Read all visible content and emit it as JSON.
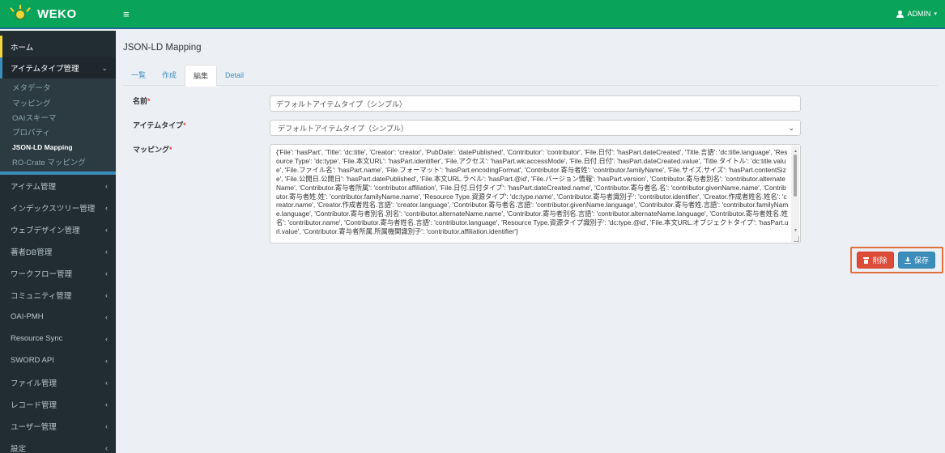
{
  "app": {
    "logo_text": "WEKO"
  },
  "header": {
    "user_label": "ADMIN",
    "user_caret": "▾",
    "menu_icon": "≡"
  },
  "sidebar": {
    "home": "ホーム",
    "active_section": {
      "label": "アイテムタイプ管理",
      "chevron": "⌄"
    },
    "sub_items": [
      "メタデータ",
      "マッピング",
      "OAIスキーマ",
      "プロパティ",
      "JSON-LD Mapping",
      "RO-Crate マッピング"
    ],
    "current_sub_index": 4,
    "sections": [
      "アイテム管理",
      "インデックスツリー管理",
      "ウェブデザイン管理",
      "著者DB管理",
      "ワークフロー管理",
      "コミュニティ管理",
      "OAI-PMH",
      "Resource Sync",
      "SWORD API",
      "ファイル管理",
      "レコード管理",
      "ユーザー管理",
      "設定"
    ],
    "chevron": "‹"
  },
  "page": {
    "title": "JSON-LD Mapping",
    "tabs": [
      "一覧",
      "作成",
      "編集",
      "Detail"
    ],
    "active_tab_index": 2
  },
  "form": {
    "name_label": "名前",
    "name_value": "デフォルトアイテムタイプ（シンプル）",
    "itemtype_label": "アイテムタイプ",
    "itemtype_value": "デフォルトアイテムタイプ（シンプル）",
    "mapping_label": "マッピング",
    "required_mark": "*",
    "mapping_value": "{'File': 'hasPart', 'Title': 'dc:title', 'Creator': 'creator', 'PubDate': 'datePublished', 'Contributor': 'contributor', 'File.日付': 'hasPart.dateCreated', 'Title.言語': 'dc:title.language', 'Resource Type': 'dc:type', 'File.本文URL': 'hasPart.identifier', 'File.アクセス': 'hasPart.wk:accessMode', 'File.日付.日付': 'hasPart.dateCreated.value', 'Title.タイトル': 'dc:title.value', 'File.ファイル名': 'hasPart.name', 'File.フォーマット': 'hasPart.encodingFormat', 'Contributor.寄与者姓': 'contributor.familyName', 'File.サイズ.サイズ': 'hasPart.contentSize', 'File.公開日.公開日': 'hasPart.datePublished', 'File.本文URL.ラベル': 'hasPart.@id', 'File.バージョン情報': 'hasPart.version', 'Contributor.寄与者別名': 'contributor.alternateName', 'Contributor.寄与者所属': 'contributor.affiliation', 'File.日付.日付タイプ': 'hasPart.dateCreated.name', 'Contributor.寄与者名.名': 'contributor.givenName.name', 'Contributor.寄与者姓.姓': 'contributor.familyName.name', 'Resource Type.資源タイプ': 'dc:type.name', 'Contributor.寄与者識別子': 'contributor.identifier', 'Creator.作成者姓名.姓名': 'creator.name', 'Creator.作成者姓名.言語': 'creator.language', 'Contributor.寄与者名.言語': 'contributor.givenName.language', 'Contributor.寄与者姓.言語': 'contributor.familyName.language', 'Contributor.寄与者別名.別名': 'contributor.alternateName.name', 'Contributor.寄与者別名.言語': 'contributor.alternateName.language', 'Contributor.寄与者姓名.姓名': 'contributor.name', 'Contributor.寄与者姓名.言語': 'contributor.language', 'Resource Type.資源タイプ識別子': 'dc:type.@id', 'File.本文URL.オブジェクトタイプ': 'hasPart.url.value', 'Contributor.寄与者所属.所属機関識別子': 'contributor.affiliation.identifier'}"
  },
  "actions": {
    "delete_label": "削除",
    "save_label": "保存"
  },
  "colors": {
    "header_green": "#0aa35a",
    "sidebar_bg": "#222d32",
    "danger": "#dd4b39",
    "primary": "#3c8dbc",
    "highlight_border": "#e0703c"
  }
}
